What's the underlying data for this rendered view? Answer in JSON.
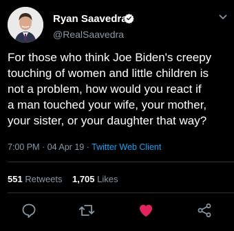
{
  "user": {
    "display_name": "Ryan Saavedra",
    "handle": "@RealSaavedra"
  },
  "tweet": {
    "lines": [
      "For those who think Joe Biden's creepy",
      "touching of women and little children is",
      "not a problem, how would you react if",
      "a man touched your wife, your mother,",
      "your sister, or your daughter that way?"
    ],
    "time": "7:00 PM",
    "date": "04 Apr 19",
    "separator": "·",
    "client": "Twitter Web Client"
  },
  "stats": {
    "retweets_count": "551",
    "retweets_label": "Retweets",
    "likes_count": "1,705",
    "likes_label": "Likes"
  },
  "actions": {
    "reply_icon": "reply-icon",
    "retweet_icon": "retweet-icon",
    "like_icon": "heart-icon",
    "share_icon": "share-icon",
    "liked": true
  },
  "colors": {
    "background": "#000000",
    "text": "#ffffff",
    "muted": "#8899a6",
    "accent": "#1da1f2",
    "like": "#e0245e"
  }
}
